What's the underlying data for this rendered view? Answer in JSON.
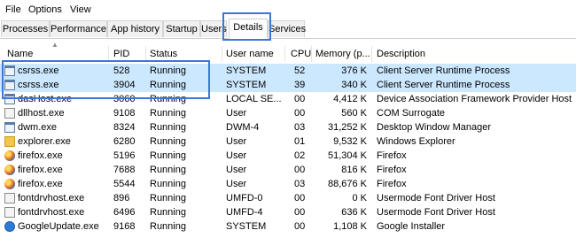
{
  "menu": [
    "File",
    "Options",
    "View"
  ],
  "tabs": [
    "Processes",
    "Performance",
    "App history",
    "Startup",
    "Users",
    "Details",
    "Services"
  ],
  "active_tab": "Details",
  "columns": [
    "Name",
    "PID",
    "Status",
    "User name",
    "CPU",
    "Memory (p...",
    "Description"
  ],
  "rows": [
    {
      "name": "csrss.exe",
      "pid": "528",
      "status": "Running",
      "user": "SYSTEM",
      "cpu": "52",
      "memory": "376 K",
      "description": "Client Server Runtime Process",
      "icon": "window-icon",
      "selected": true
    },
    {
      "name": "csrss.exe",
      "pid": "3904",
      "status": "Running",
      "user": "SYSTEM",
      "cpu": "39",
      "memory": "340 K",
      "description": "Client Server Runtime Process",
      "icon": "window-icon",
      "selected": true
    },
    {
      "name": "dasHost.exe",
      "pid": "3060",
      "status": "Running",
      "user": "LOCAL SE...",
      "cpu": "00",
      "memory": "4,412 K",
      "description": "Device Association Framework Provider Host",
      "icon": "window-icon",
      "selected": false
    },
    {
      "name": "dllhost.exe",
      "pid": "9108",
      "status": "Running",
      "user": "User",
      "cpu": "00",
      "memory": "560 K",
      "description": "COM Surrogate",
      "icon": "generic-icon",
      "selected": false
    },
    {
      "name": "dwm.exe",
      "pid": "8324",
      "status": "Running",
      "user": "DWM-4",
      "cpu": "03",
      "memory": "31,252 K",
      "description": "Desktop Window Manager",
      "icon": "window-icon",
      "selected": false
    },
    {
      "name": "explorer.exe",
      "pid": "6280",
      "status": "Running",
      "user": "User",
      "cpu": "01",
      "memory": "9,532 K",
      "description": "Windows Explorer",
      "icon": "folder-icon",
      "selected": false
    },
    {
      "name": "firefox.exe",
      "pid": "5196",
      "status": "Running",
      "user": "User",
      "cpu": "02",
      "memory": "51,304 K",
      "description": "Firefox",
      "icon": "firefox-icon",
      "selected": false
    },
    {
      "name": "firefox.exe",
      "pid": "7688",
      "status": "Running",
      "user": "User",
      "cpu": "00",
      "memory": "816 K",
      "description": "Firefox",
      "icon": "firefox-icon",
      "selected": false
    },
    {
      "name": "firefox.exe",
      "pid": "5544",
      "status": "Running",
      "user": "User",
      "cpu": "03",
      "memory": "88,676 K",
      "description": "Firefox",
      "icon": "firefox-icon",
      "selected": false
    },
    {
      "name": "fontdrvhost.exe",
      "pid": "896",
      "status": "Running",
      "user": "UMFD-0",
      "cpu": "00",
      "memory": "0 K",
      "description": "Usermode Font Driver Host",
      "icon": "generic-icon",
      "selected": false
    },
    {
      "name": "fontdrvhost.exe",
      "pid": "6496",
      "status": "Running",
      "user": "UMFD-4",
      "cpu": "00",
      "memory": "636 K",
      "description": "Usermode Font Driver Host",
      "icon": "generic-icon",
      "selected": false
    },
    {
      "name": "GoogleUpdate.exe",
      "pid": "9168",
      "status": "Running",
      "user": "SYSTEM",
      "cpu": "00",
      "memory": "1,108 K",
      "description": "Google Installer",
      "icon": "google-icon",
      "selected": false
    }
  ],
  "colors": {
    "selection": "#cce8ff",
    "highlight_border": "#3a78d8"
  }
}
